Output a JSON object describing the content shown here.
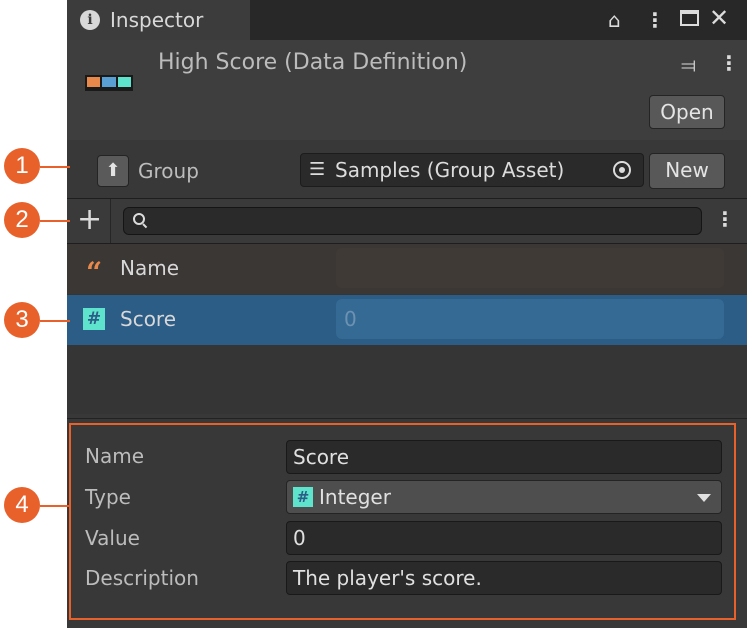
{
  "window": {
    "tab_title": "Inspector",
    "tab_icon": "info-icon",
    "toolbar_icons": [
      "lock-icon",
      "kebab-menu-icon",
      "maximize-icon",
      "close-icon"
    ]
  },
  "header": {
    "title": "High Score (Data Definition)",
    "asset_icon": "data-definition-icon",
    "open_label": "Open"
  },
  "group": {
    "label": "Group",
    "value": "Samples (Group Asset)",
    "new_label": "New"
  },
  "toolbar": {
    "search_value": ""
  },
  "list": {
    "items": [
      {
        "icon": "string-quote-icon",
        "label": "Name",
        "value": "",
        "selected": false
      },
      {
        "icon": "integer-hash-icon",
        "label": "Score",
        "value": "0",
        "selected": true
      }
    ]
  },
  "details": {
    "fields": [
      {
        "label": "Name",
        "value": "Score"
      },
      {
        "label": "Type",
        "value": "Integer",
        "icon": "#"
      },
      {
        "label": "Value",
        "value": "0"
      },
      {
        "label": "Description",
        "value": "The player's score."
      }
    ]
  },
  "callouts": [
    "1",
    "2",
    "3",
    "4"
  ],
  "colors": {
    "accent": "#e8612b",
    "selection": "#2c5d87",
    "integer_icon": "#5ee4cc",
    "string_icon": "#e8884a",
    "asset_icon": [
      "#e8884a",
      "#5a9fd4",
      "#5ee4cc"
    ]
  }
}
